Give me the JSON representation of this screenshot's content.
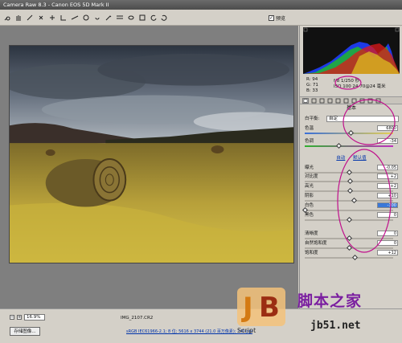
{
  "window": {
    "title": "Camera Raw 8.3 - Canon EOS 5D Mark II"
  },
  "toolbar": {
    "tools": [
      "zoom-icon",
      "hand-icon",
      "white-balance-icon",
      "color-sampler-icon",
      "targeted-adjust-icon",
      "crop-icon",
      "straighten-icon",
      "spot-removal-icon",
      "red-eye-icon",
      "adjustment-brush-icon",
      "graduated-filter-icon",
      "radial-filter-icon",
      "preferences-icon",
      "rotate-left-icon",
      "rotate-right-icon"
    ],
    "preview_label": "预览",
    "preview_checked": "✓"
  },
  "readout": {
    "r": "R:   94",
    "g": "G:   71",
    "b": "B:   33",
    "aperture": "f/8  1/250 秒",
    "iso": "ISO 100  24-70@24 毫米"
  },
  "panel": {
    "section_title": "基本",
    "wb_label": "白平衡:",
    "wb_value": "自定",
    "sliders": [
      {
        "label": "色温",
        "value": "6800",
        "pos": 0.52
      },
      {
        "label": "色调",
        "value": "-34",
        "pos": 0.38
      },
      {
        "label": "曝光",
        "value": "-0.05",
        "pos": 0.5
      },
      {
        "label": "对比度",
        "value": "+2",
        "pos": 0.51
      },
      {
        "label": "高光",
        "value": "+2",
        "pos": 0.51
      },
      {
        "label": "阴影",
        "value": "+10",
        "pos": 0.55
      },
      {
        "label": "白色",
        "value": "-100",
        "pos": 0.0
      },
      {
        "label": "黑色",
        "value": "0",
        "pos": 0.5
      },
      {
        "label": "清晰度",
        "value": "0",
        "pos": 0.5
      },
      {
        "label": "自然饱和度",
        "value": "0",
        "pos": 0.5
      },
      {
        "label": "饱和度",
        "value": "+12",
        "pos": 0.56
      }
    ],
    "auto_label": "自动",
    "default_label": "默认值"
  },
  "bottom": {
    "zoom": "16.9%",
    "filename": "IMG_2107.CR2",
    "save_label": "存储图像...",
    "workflow_link": "sRGB IEC61966-2.1; 8 位; 5616 x 3744 (21.0 百万像素); 240 ppi"
  },
  "watermark": {
    "brand": "脚本之家",
    "url": "jb51.net",
    "script": "Script"
  },
  "colors": {
    "accent": "#3a78d8",
    "annotation": "#c0108c",
    "watermark": "#7a1ea0"
  }
}
